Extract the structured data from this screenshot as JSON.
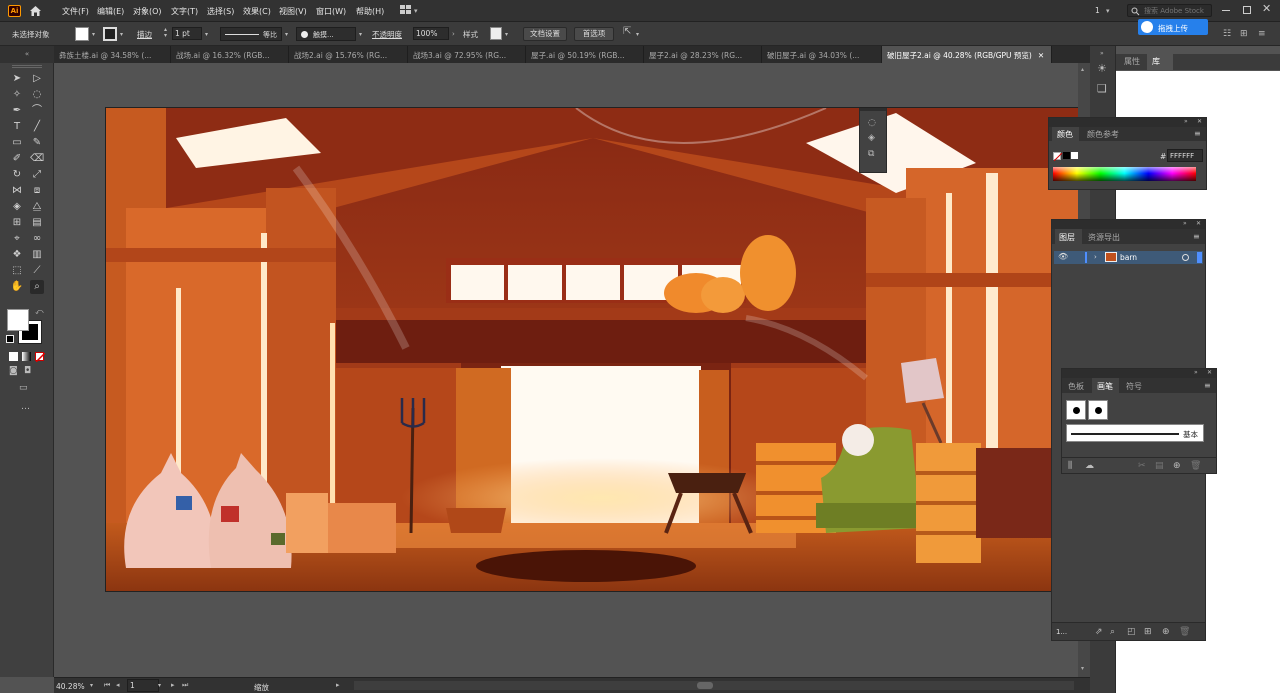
{
  "app": {
    "logo": "Ai"
  },
  "menu": [
    "文件(F)",
    "编辑(E)",
    "对象(O)",
    "文字(T)",
    "选择(S)",
    "效果(C)",
    "视图(V)",
    "窗口(W)",
    "帮助(H)"
  ],
  "topbar": {
    "page_num": "1",
    "search_placeholder": "搜索 Adobe Stock",
    "upload_label": "拖拽上传"
  },
  "control": {
    "selection_status": "未选择对象",
    "stroke_label": "描边",
    "stroke_value": "1 pt",
    "stroke_profile": "等比",
    "brush_label": "触摸...",
    "opacity_label": "不透明度",
    "opacity_value": "100%",
    "style_label": "样式",
    "doc_setup": "文档设置",
    "preferences": "首选项"
  },
  "tabs": [
    "彝族土楼.ai @ 34.58% (...",
    "战场.ai @ 16.32% (RGB...",
    "战场2.ai @ 15.76% (RG...",
    "战场3.ai @ 72.95% (RG...",
    "屋子.ai @ 50.19% (RGB...",
    "屋子2.ai @ 28.23% (RG...",
    "破旧屋子.ai @ 34.03% (...",
    "破旧屋子2.ai @ 40.28% (RGB/GPU 预览)"
  ],
  "status": {
    "zoom": "40.28%",
    "artboard": "1",
    "tool": "缩放"
  },
  "dock_tabs": {
    "properties": "属性",
    "libraries": "库"
  },
  "color_panel": {
    "tab_color": "颜色",
    "tab_guide": "颜色参考",
    "hex_symbol": "#",
    "hex_value": "FFFFFF"
  },
  "layers_panel": {
    "tab_layers": "图层",
    "tab_assets": "资源导出",
    "layer_name": "barn",
    "count": "1..."
  },
  "brushes_panel": {
    "tab_swatches": "色板",
    "tab_brushes": "画笔",
    "tab_symbols": "符号",
    "basic_label": "基本"
  },
  "colors": {
    "accent": "#2680eb",
    "menubar": "#323232",
    "panel": "#424242",
    "canvas": "#535353"
  }
}
